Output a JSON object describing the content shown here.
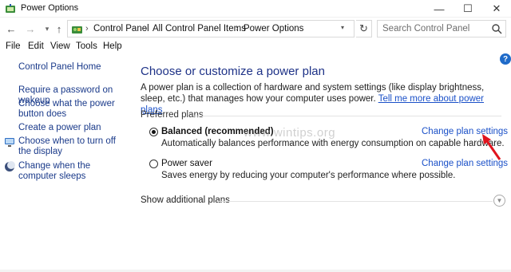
{
  "window": {
    "title": "Power Options",
    "controls": {
      "minimize": "—",
      "maximize": "☐",
      "close": "✕"
    }
  },
  "address": {
    "breadcrumbs": [
      "Control Panel",
      "All Control Panel Items",
      "Power Options"
    ],
    "search_placeholder": "Search Control Panel"
  },
  "menu": [
    "File",
    "Edit",
    "View",
    "Tools",
    "Help"
  ],
  "sidebar": {
    "home": "Control Panel Home",
    "links": [
      "Require a password on wakeup",
      "Choose what the power button does",
      "Create a power plan",
      "Choose when to turn off the display",
      "Change when the computer sleeps"
    ]
  },
  "main": {
    "heading": "Choose or customize a power plan",
    "description": "A power plan is a collection of hardware and system settings (like display brightness, sleep, etc.) that manages how your computer uses power.",
    "description_link": "Tell me more about power plans",
    "group_label": "Preferred plans",
    "plans": [
      {
        "name": "Balanced (recommended)",
        "description": "Automatically balances performance with energy consumption on capable hardware.",
        "link": "Change plan settings",
        "selected": true
      },
      {
        "name": "Power saver",
        "description": "Saves energy by reducing your computer's performance where possible.",
        "link": "Change plan settings",
        "selected": false
      }
    ],
    "show_additional": "Show additional plans"
  },
  "watermark": "www.wintips.org",
  "colors": {
    "heading": "#1e3287",
    "link": "#1a50c8",
    "annotation_arrow": "#e0141e"
  }
}
